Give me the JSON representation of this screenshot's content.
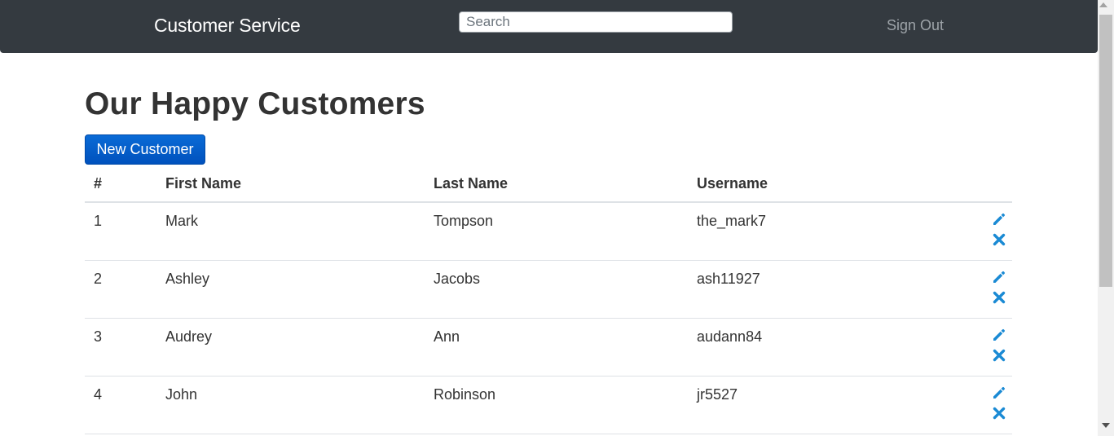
{
  "navbar": {
    "brand": "Customer Service",
    "search_placeholder": "Search",
    "sign_out": "Sign Out"
  },
  "main": {
    "title": "Our Happy Customers",
    "new_button": "New Customer"
  },
  "table": {
    "headers": [
      "#",
      "First Name",
      "Last Name",
      "Username"
    ],
    "rows": [
      {
        "num": "1",
        "first": "Mark",
        "last": "Tompson",
        "user": "the_mark7"
      },
      {
        "num": "2",
        "first": "Ashley",
        "last": "Jacobs",
        "user": "ash11927"
      },
      {
        "num": "3",
        "first": "Audrey",
        "last": "Ann",
        "user": "audann84"
      },
      {
        "num": "4",
        "first": "John",
        "last": "Robinson",
        "user": "jr5527"
      }
    ]
  },
  "colors": {
    "navbar": "#343a40",
    "primary": "#0a6bd6",
    "action_icon": "#1a8ad4"
  },
  "icons": {
    "edit": "pencil-icon",
    "delete": "close-icon"
  }
}
